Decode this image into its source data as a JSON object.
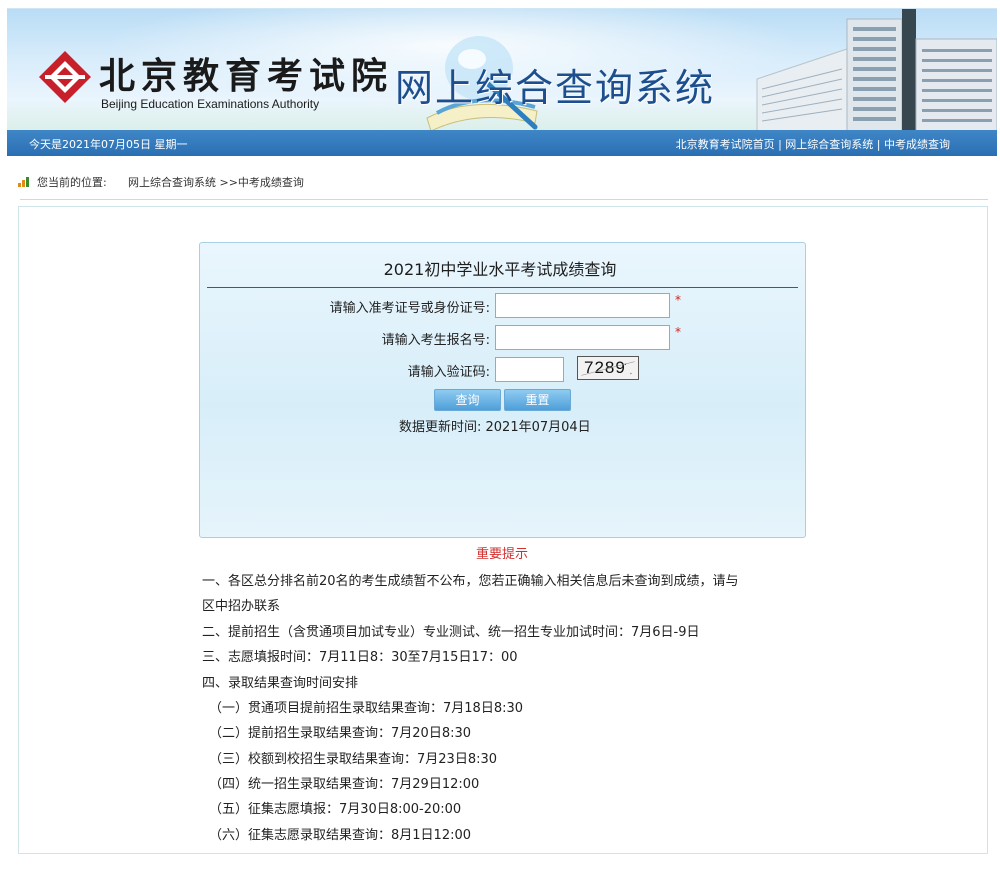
{
  "header": {
    "org_name_cn": "北京教育考试院",
    "org_name_en": "Beijing Education Examinations Authority",
    "system_title": "网上综合查询系统"
  },
  "navbar": {
    "date_text": "今天是2021年07月05日 星期一",
    "links": [
      "北京教育考试院首页",
      "网上综合查询系统",
      "中考成绩查询"
    ],
    "separator": " | "
  },
  "breadcrumb": {
    "label": "您当前的位置:",
    "path": "网上综合查询系统 >>中考成绩查询"
  },
  "form": {
    "title": "2021初中学业水平考试成绩查询",
    "fields": [
      {
        "label": "请输入准考证号或身份证号:",
        "value": "",
        "required": true
      },
      {
        "label": "请输入考生报名号:",
        "value": "",
        "required": true
      },
      {
        "label": "请输入验证码:",
        "value": "",
        "required": false
      }
    ],
    "required_mark": "*",
    "captcha_text": "7289",
    "query_button": "查询",
    "reset_button": "重置",
    "updated_text": "数据更新时间: 2021年07月04日"
  },
  "notice": {
    "title": "重要提示",
    "lines": [
      "一、各区总分排名前20名的考生成绩暂不公布，您若正确输入相关信息后未查询到成绩，请与",
      "区中招办联系",
      "二、提前招生（含贯通项目加试专业）专业测试、统一招生专业加试时间：7月6日-9日",
      "三、志愿填报时间：7月11日8：30至7月15日17：00",
      "四、录取结果查询时间安排",
      "（一）贯通项目提前招生录取结果查询：7月18日8:30",
      "（二）提前招生录取结果查询：7月20日8:30",
      "（三）校额到校招生录取结果查询：7月23日8:30",
      "（四）统一招生录取结果查询：7月29日12:00",
      "（五）征集志愿填报：7月30日8:00-20:00",
      "（六）征集志愿录取结果查询：8月1日12:00"
    ]
  },
  "colors": {
    "nav_blue": "#2a6fb2",
    "title_blue": "#1d4f8f",
    "alert_red": "#d23030",
    "logo_red": "#c8202a"
  },
  "icons": {
    "logo": "bjeea-logo-icon",
    "breadcrumb": "location-bars-icon"
  }
}
